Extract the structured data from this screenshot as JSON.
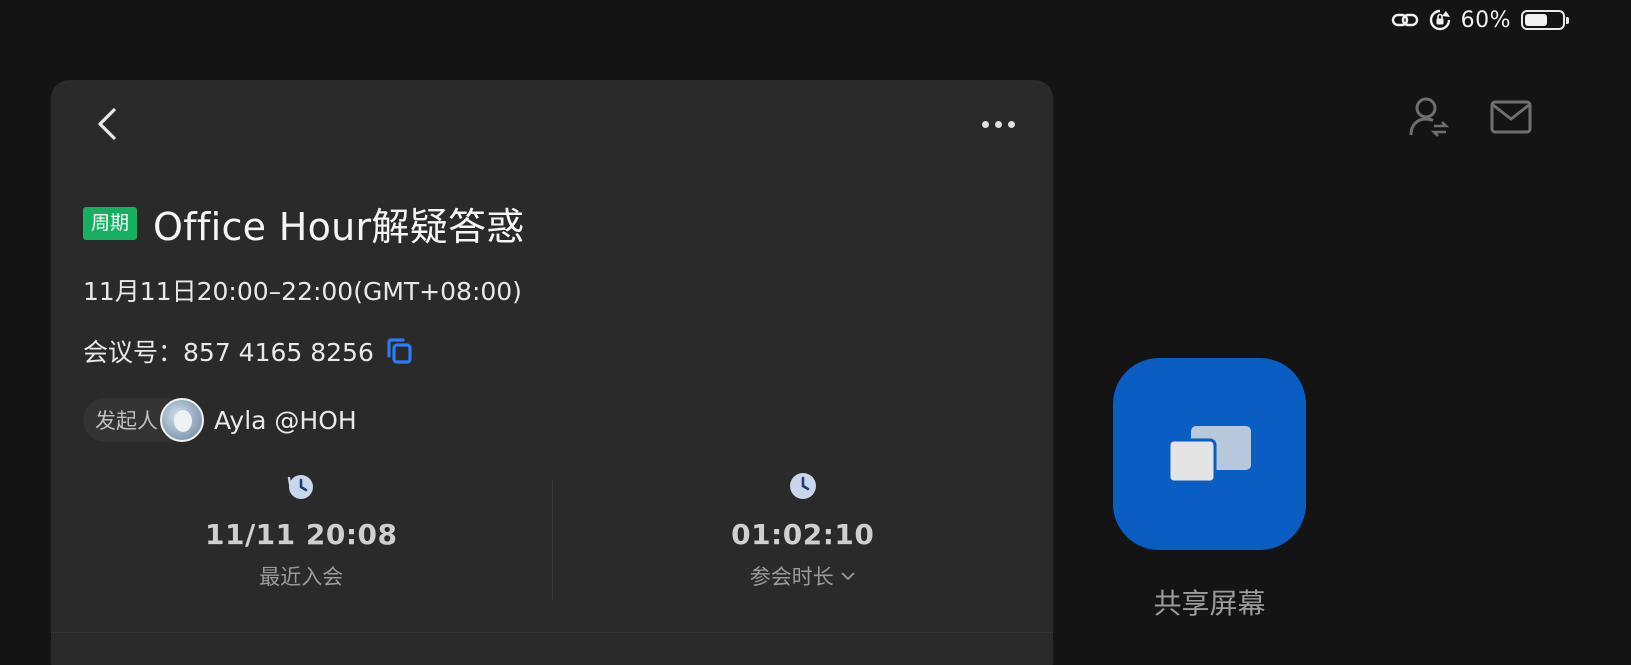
{
  "status_bar": {
    "battery_percent_text": "60%",
    "battery_level": 0.6
  },
  "toolbar": {
    "icons": [
      "user-switch-icon",
      "mail-icon"
    ]
  },
  "meeting": {
    "tag": "周期",
    "title": "Office Hour解疑答惑",
    "time_range": "11月11日20:00–22:00(GMT+08:00)",
    "meeting_id_label": "会议号：",
    "meeting_id": "857 4165 8256",
    "organizer_label": "发起人",
    "organizer_name": "Ayla @HOH",
    "stats": [
      {
        "icon": "history-clock-icon",
        "value": "11/11 20:08",
        "label": "最近入会"
      },
      {
        "icon": "clock-icon",
        "value": "01:02:10",
        "label": "参会时长"
      }
    ]
  },
  "share": {
    "label": "共享屏幕"
  },
  "colors": {
    "accent_blue": "#0a5dc2",
    "tag_green": "#16b061",
    "copy_icon_blue": "#2f7bf2"
  }
}
